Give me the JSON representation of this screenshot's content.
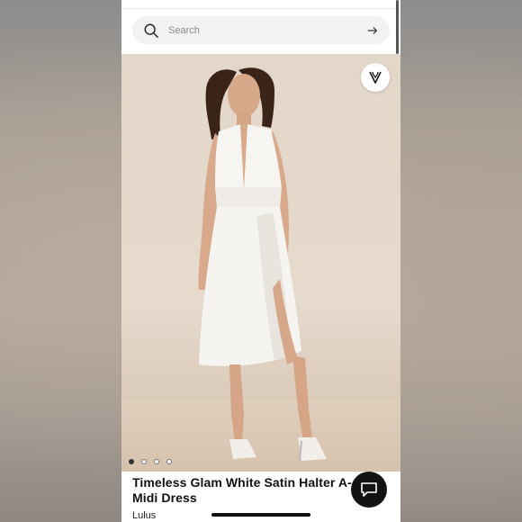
{
  "search": {
    "placeholder": "Search"
  },
  "product": {
    "title_line1": "Timeless Glam White Satin Halter A-",
    "title_line2": "Midi Dress",
    "brand": "Lulus",
    "image_count": 4,
    "active_image": 1
  },
  "icons": {
    "search": "search-icon",
    "submit": "arrow-right-icon",
    "favorite": "heart-check-icon",
    "chat": "chat-bubble-icon"
  },
  "colors": {
    "photo_background": "#e3d7ca",
    "dress": "#f7f5f2",
    "chat_button": "#121212"
  }
}
